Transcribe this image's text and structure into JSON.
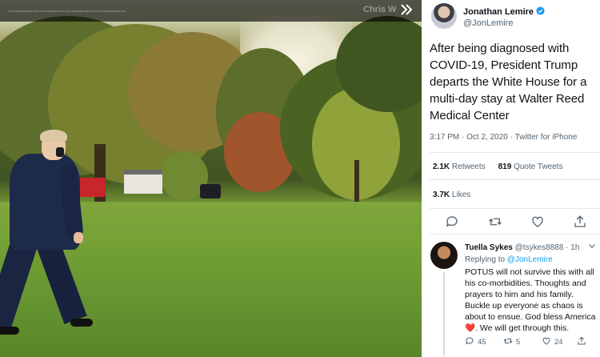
{
  "media": {
    "topbar_ghost_right": "Chris W",
    "topbar_ghost_left": "................................................",
    "collapse_icon": "double-chevron-right-icon"
  },
  "tweet": {
    "author_name": "Jonathan Lemire",
    "author_handle": "@JonLemire",
    "verified": true,
    "text": "After being diagnosed with COVID-19, President Trump departs the White House for a multi-day stay at Walter Reed Medical Center",
    "time": "3:17 PM",
    "date": "Oct 2, 2020",
    "source": "Twitter for iPhone",
    "retweets_count": "2.1K",
    "retweets_label": "Retweets",
    "quote_count": "819",
    "quote_label": "Quote Tweets",
    "likes_count": "3.7K",
    "likes_label": "Likes",
    "actions": [
      "reply-icon",
      "retweet-icon",
      "like-icon",
      "share-icon"
    ]
  },
  "reply": {
    "name": "Tuella Sykes",
    "handle": "@tsykes8888",
    "separator": "·",
    "age": "1h",
    "replying_prefix": "Replying to",
    "replying_to": "@JonLemire",
    "text_before_heart": "POTUS will not survive this with all his co-morbidities. Thoughts and prayers to him and his family. Buckle up everyone as chaos is about to ensue. God bless America",
    "heart": "❤️",
    "text_after_heart": ". We will get through this.",
    "reply_count": "45",
    "retweet_count": "5",
    "like_count": "24"
  },
  "colors": {
    "link": "#1d9bf0",
    "verified": "#1d9bf0",
    "text_primary": "#0f1419",
    "text_secondary": "#536471",
    "heart": "#e0245e"
  }
}
